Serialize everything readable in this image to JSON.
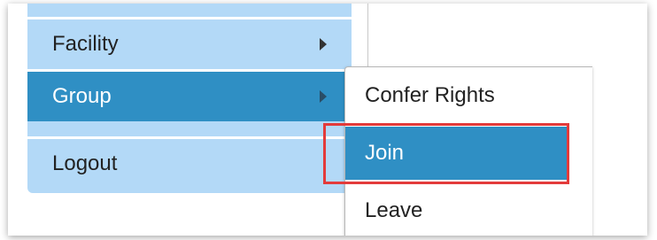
{
  "menu": {
    "items": [
      {
        "label": "Facility",
        "has_submenu": true,
        "active": false
      },
      {
        "label": "Group",
        "has_submenu": true,
        "active": true
      },
      {
        "label": "Logout",
        "has_submenu": false,
        "active": false
      }
    ]
  },
  "submenu": {
    "items": [
      {
        "label": "Confer Rights",
        "active": false
      },
      {
        "label": "Join",
        "active": true,
        "highlighted": true
      },
      {
        "label": "Leave",
        "active": false
      }
    ]
  },
  "colors": {
    "menu_bg": "#b3d9f7",
    "active_bg": "#2f8fc4",
    "highlight_border": "#e33b3b"
  }
}
